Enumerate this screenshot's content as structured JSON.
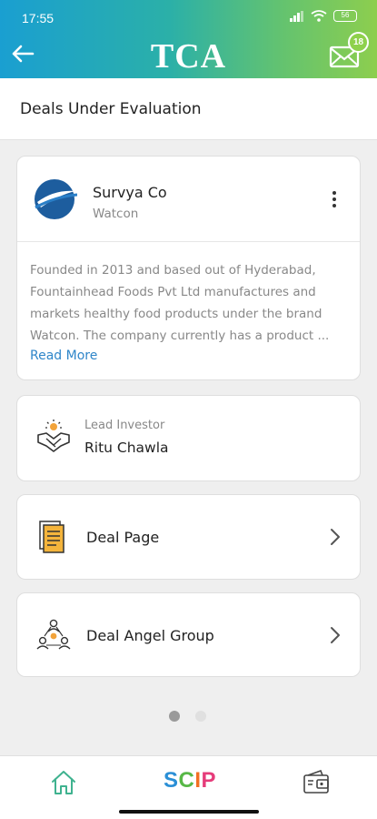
{
  "status_bar": {
    "time": "17:55",
    "battery": "56"
  },
  "header": {
    "brand": "TCA",
    "notification_count": "18"
  },
  "page": {
    "title": "Deals Under Evaluation"
  },
  "company": {
    "name": "Survya Co",
    "subtitle": "Watcon",
    "description": "Founded in 2013 and based out of Hyderabad, Fountainhead Foods Pvt Ltd manufactures and markets healthy food products under the brand Watcon. The company currently has a product ...",
    "read_more": "Read More"
  },
  "lead_investor": {
    "label": "Lead Investor",
    "name": "Ritu Chawla"
  },
  "links": [
    {
      "label": "Deal Page",
      "icon": "document-icon"
    },
    {
      "label": "Deal Angel Group",
      "icon": "group-icon"
    }
  ],
  "pagination": {
    "total": 2,
    "active": 1
  },
  "bottom_nav": {
    "scip": {
      "s": "S",
      "c": "C",
      "i": "I",
      "p": "P"
    }
  },
  "colors": {
    "brand_gradient_start": "#1a9fd1",
    "brand_gradient_end": "#8dce4e",
    "link": "#2f86c9"
  }
}
